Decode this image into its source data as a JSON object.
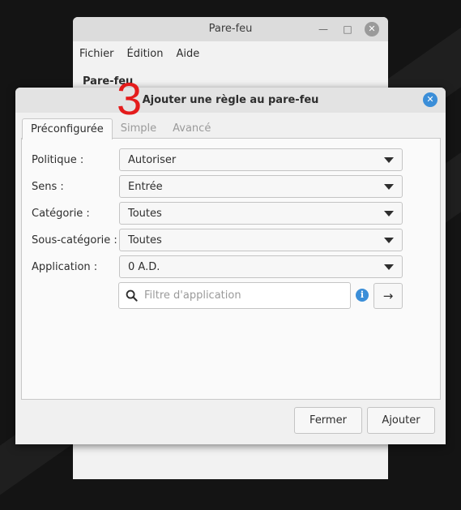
{
  "parent_window": {
    "title": "Pare-feu",
    "menu": [
      "Fichier",
      "Édition",
      "Aide"
    ],
    "subtitle": "Pare-feu"
  },
  "dialog": {
    "title": "Ajouter une règle au pare-feu",
    "step_marker": "3",
    "tabs": [
      "Préconfigurée",
      "Simple",
      "Avancé"
    ],
    "active_tab": "Préconfigurée",
    "fields": {
      "politique": {
        "label": "Politique :",
        "value": "Autoriser"
      },
      "sens": {
        "label": "Sens :",
        "value": "Entrée"
      },
      "categorie": {
        "label": "Catégorie :",
        "value": "Toutes"
      },
      "sous_categorie": {
        "label": "Sous-catégorie :",
        "value": "Toutes"
      },
      "application": {
        "label": "Application :",
        "value": "0 A.D."
      }
    },
    "filter": {
      "placeholder": "Filtre d'application",
      "value": ""
    },
    "buttons": {
      "close": "Fermer",
      "add": "Ajouter"
    }
  },
  "colors": {
    "accent": "#3b8ed8",
    "step_marker": "#e41c1c"
  }
}
